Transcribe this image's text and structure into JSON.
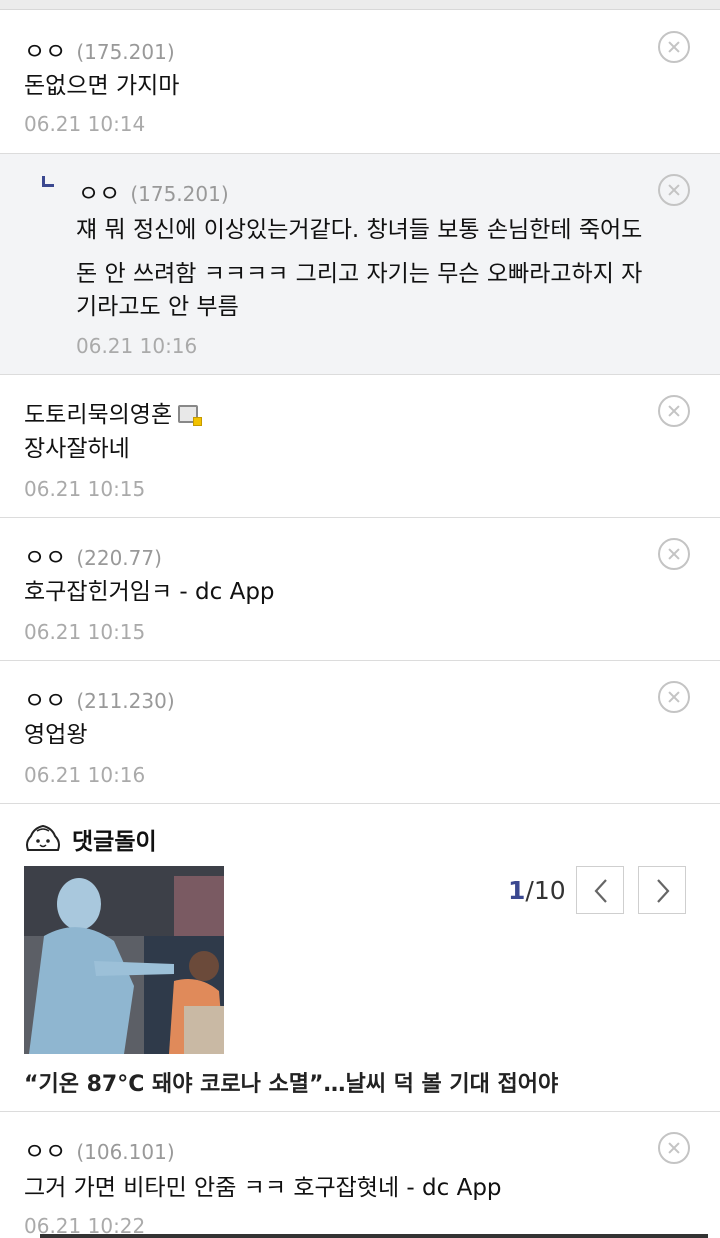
{
  "comments": [
    {
      "nick": "ㅇㅇ",
      "ip": "(175.201)",
      "text": "돈없으면 가지마",
      "date": "06.21 10:14"
    },
    {
      "nick": "ㅇㅇ",
      "ip": "(175.201)",
      "lines": [
        "쟤 뭐 정신에 이상있는거같다. 창녀들 보통 손님한테 죽어도",
        "돈 안 쓰려함 ㅋㅋㅋㅋ 그리고 자기는 무슨 오빠라고하지 자",
        "기라고도 안 부름"
      ],
      "date": "06.21 10:16"
    },
    {
      "nick": "도토리묵의영혼",
      "text": "장사잘하네",
      "date": "06.21 10:15"
    },
    {
      "nick": "ㅇㅇ",
      "ip": "(220.77)",
      "text": "호구잡힌거임ㅋ - dc App",
      "date": "06.21 10:15"
    },
    {
      "nick": "ㅇㅇ",
      "ip": "(211.230)",
      "text": "영업왕",
      "date": "06.21 10:16"
    },
    {
      "nick": "ㅇㅇ",
      "ip": "(106.101)",
      "text": "그거 가면 비타민 안줌 ㅋㅋ 호구잡혓네 - dc App",
      "date": "06.21 10:22"
    }
  ],
  "dotgul": {
    "title": "댓글돌이",
    "page_current": "1",
    "page_total": "/10",
    "headline": "“기온 87°C 돼야 코로나 소멸”…날씨 덕 볼 기대 접어야"
  },
  "icons": {
    "delete": "close-circle-icon",
    "reply": "reply-arrow-icon",
    "gallery": "gallery-member-icon",
    "mascot": "dotgul-mascot-icon",
    "prev": "chevron-left-icon",
    "next": "chevron-right-icon"
  },
  "colors": {
    "accent": "#3b4890",
    "reply_bg": "#f3f4f6",
    "muted": "#aaaaaa"
  }
}
